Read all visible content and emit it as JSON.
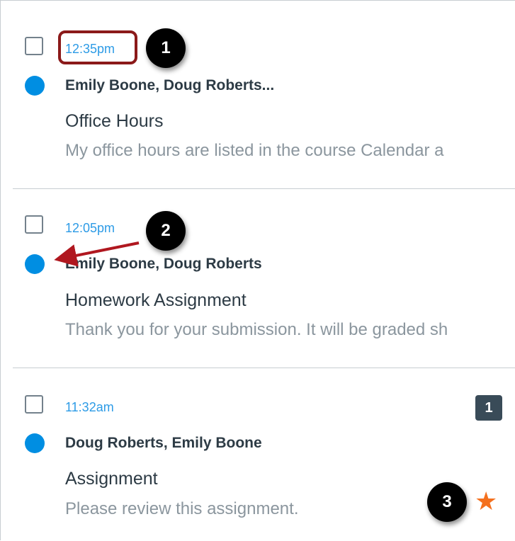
{
  "messages": [
    {
      "time": "12:35pm",
      "participants": "Emily Boone, Doug Roberts...",
      "subject": "Office Hours",
      "preview": "My office hours are listed in the course Calendar a"
    },
    {
      "time": "12:05pm",
      "participants": "Emily Boone, Doug Roberts",
      "subject": "Homework Assignment",
      "preview": "Thank you for your submission. It will be graded sh"
    },
    {
      "time": "11:32am",
      "participants": "Doug Roberts, Emily Boone",
      "subject": "Assignment",
      "preview": "Please review this assignment.",
      "message_count": "1",
      "starred": true
    }
  ],
  "callouts": [
    "1",
    "2",
    "3"
  ],
  "colors": {
    "time_link": "#2d9be6",
    "unread_dot": "#008ee2",
    "star": "#f4701e",
    "highlight": "#8b1a1a",
    "badge": "#394b58"
  },
  "icons": {
    "unread": "unread-dot-icon",
    "star": "star-icon",
    "checkbox": "checkbox-icon"
  }
}
